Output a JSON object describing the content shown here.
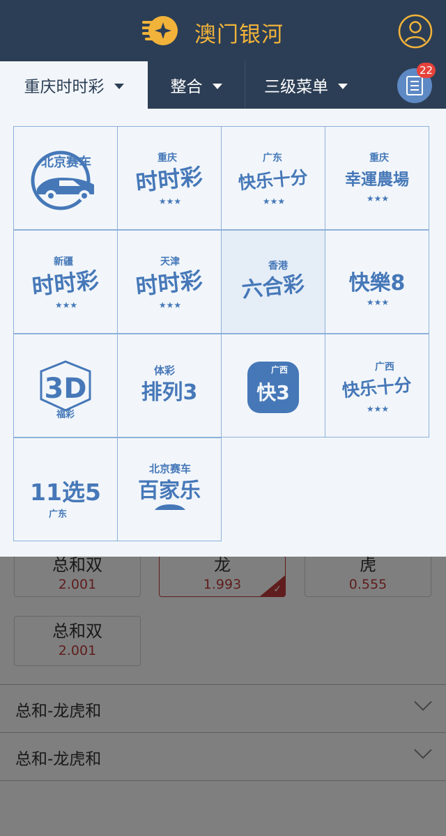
{
  "header": {
    "title": "澳门银河"
  },
  "tabs": [
    {
      "label": "重庆时时彩"
    },
    {
      "label": "整合"
    },
    {
      "label": "三级菜单"
    }
  ],
  "notification_count": "22",
  "lottery_grid": [
    {
      "name": "北京赛车",
      "top": "",
      "main": "北京赛车",
      "icon": "race-car"
    },
    {
      "name": "重庆时时彩",
      "top": "重庆",
      "main": "时时彩",
      "icon": "stars"
    },
    {
      "name": "广东快乐十分",
      "top": "广东",
      "main": "快乐十分",
      "icon": "stars"
    },
    {
      "name": "重庆幸運農場",
      "top": "重庆",
      "main": "幸運農場",
      "icon": "stars"
    },
    {
      "name": "新疆时时彩",
      "top": "新疆",
      "main": "时时彩",
      "icon": "stars"
    },
    {
      "name": "天津时时彩",
      "top": "天津",
      "main": "时时彩",
      "icon": "stars"
    },
    {
      "name": "香港六合彩",
      "top": "香港",
      "main": "六合彩",
      "icon": "none"
    },
    {
      "name": "快樂8",
      "top": "",
      "main": "快樂8",
      "icon": "stars"
    },
    {
      "name": "福彩3D",
      "top": "",
      "main": "3D",
      "sub": "福彩",
      "icon": "cube"
    },
    {
      "name": "体彩排列3",
      "top": "体彩",
      "main": "排列3",
      "icon": "none"
    },
    {
      "name": "广西快3",
      "top": "广西",
      "main": "快3",
      "icon": "dice"
    },
    {
      "name": "广西快乐十分",
      "top": "广西",
      "main": "快乐十分",
      "icon": "stars"
    },
    {
      "name": "广东11选5",
      "top": "",
      "main": "11选5",
      "sub": "广东",
      "icon": "none"
    },
    {
      "name": "北京赛车百家乐",
      "top": "北京赛车",
      "main": "百家乐",
      "icon": "car"
    }
  ],
  "odds_buttons": [
    {
      "name": "总和双",
      "value": "2.001",
      "selected": false
    },
    {
      "name": "龙",
      "value": "1.993",
      "selected": true
    },
    {
      "name": "虎",
      "value": "0.555",
      "selected": false
    },
    {
      "name": "总和双",
      "value": "2.001",
      "selected": false
    }
  ],
  "groups": [
    {
      "label": "总和-龙虎和"
    },
    {
      "label": "总和-龙虎和"
    }
  ],
  "colors": {
    "header_bg": "#2c3e55",
    "accent_gold": "#f2b33a",
    "logo_blue": "#4678b8",
    "odds_red": "#c03b3b",
    "badge_red": "#e6423a"
  }
}
